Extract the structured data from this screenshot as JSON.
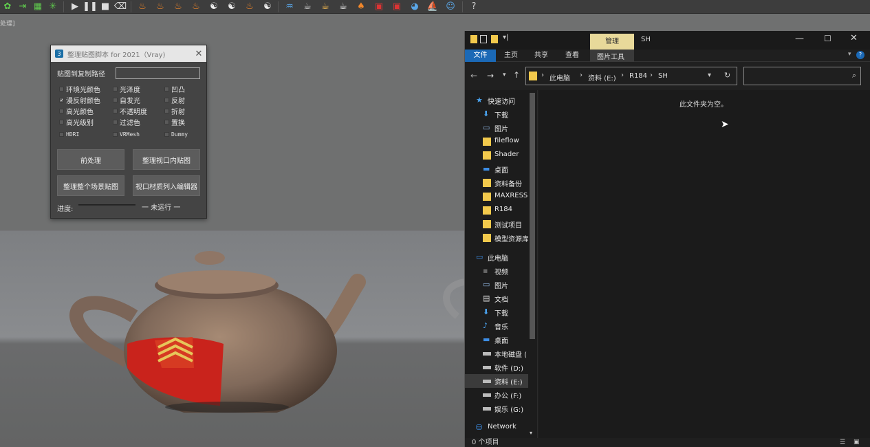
{
  "viewport_label": "处理]",
  "plugin_dialog": {
    "title": "整理贴图脚本 for 2021（Vray)",
    "logo_text": "3",
    "path_label": "贴图到复制路径",
    "path_value": "",
    "checkboxes": [
      {
        "label": "环境光颜色",
        "checked": false
      },
      {
        "label": "光泽度",
        "checked": false
      },
      {
        "label": "凹凸",
        "checked": false
      },
      {
        "label": "漫反射颜色",
        "checked": true
      },
      {
        "label": "自发光",
        "checked": false
      },
      {
        "label": "反射",
        "checked": false
      },
      {
        "label": "高光颜色",
        "checked": false
      },
      {
        "label": "不透明度",
        "checked": false
      },
      {
        "label": "折射",
        "checked": false
      },
      {
        "label": "高光级别",
        "checked": false
      },
      {
        "label": "过滤色",
        "checked": false
      },
      {
        "label": "置换",
        "checked": false
      },
      {
        "label": "HDRI",
        "checked": false
      },
      {
        "label": "VRMesh",
        "checked": false
      },
      {
        "label": "Dummy",
        "checked": false
      }
    ],
    "buttons": [
      "前处理",
      "整理视口内贴图",
      "整理整个场景贴图",
      "视口材质列入编辑器"
    ],
    "progress_label": "进度:",
    "progress_value": 0,
    "progress_status": "一 未运行 一"
  },
  "explorer": {
    "manage_tab": "管理",
    "window_title": "SH",
    "ribbon_tabs": [
      "文件",
      "主页",
      "共享",
      "查看"
    ],
    "tools_tab": "图片工具",
    "address": [
      "此电脑",
      "资料 (E:)",
      "R184",
      "SH"
    ],
    "search_placeholder": "",
    "empty_message": "此文件夹为空。",
    "status": "0 个项目",
    "nav_items": [
      {
        "label": "快速访问",
        "icon": "star-icon"
      },
      {
        "label": "下载",
        "icon": "download-icon"
      },
      {
        "label": "图片",
        "icon": "picture-icon"
      },
      {
        "label": "fileflow",
        "icon": "folder-icon"
      },
      {
        "label": "Shader",
        "icon": "folder-icon"
      },
      {
        "label": "桌面",
        "icon": "desktop-icon"
      },
      {
        "label": "资料备份",
        "icon": "folder-icon"
      },
      {
        "label": "MAXRESS",
        "icon": "folder-icon"
      },
      {
        "label": "R184",
        "icon": "folder-icon"
      },
      {
        "label": "测试项目",
        "icon": "folder-icon"
      },
      {
        "label": "模型资源库",
        "icon": "folder-icon"
      },
      {
        "label": "此电脑",
        "icon": "computer-icon"
      },
      {
        "label": "视频",
        "icon": "video-icon"
      },
      {
        "label": "图片",
        "icon": "picture-icon"
      },
      {
        "label": "文档",
        "icon": "document-icon"
      },
      {
        "label": "下载",
        "icon": "download-icon"
      },
      {
        "label": "音乐",
        "icon": "music-icon"
      },
      {
        "label": "桌面",
        "icon": "desktop-icon"
      },
      {
        "label": "本地磁盘 (",
        "icon": "drive-icon"
      },
      {
        "label": "软件 (D:)",
        "icon": "drive-icon"
      },
      {
        "label": "资料 (E:)",
        "icon": "drive-icon",
        "selected": true
      },
      {
        "label": "办公 (F:)",
        "icon": "drive-icon"
      },
      {
        "label": "娱乐 (G:)",
        "icon": "drive-icon"
      },
      {
        "label": "Network",
        "icon": "network-icon"
      }
    ]
  },
  "toolbar_icons": [
    "teapot-icon",
    "move-icon",
    "grid-icon",
    "burst-icon",
    "play-icon",
    "pause-icon",
    "stop-icon",
    "trash-icon",
    "flame-icon",
    "flame-icon",
    "flame-icon",
    "flame-icon",
    "swirl-icon",
    "swirl-icon",
    "flame-icon",
    "swirl-icon",
    "water-icon",
    "teapot-icon",
    "cup-icon",
    "cup-icon",
    "bucket-icon",
    "cube-icon",
    "cube-icon",
    "sphere-icon",
    "sail-icon",
    "face-icon",
    "help-icon"
  ],
  "colors": {
    "explorer_accent": "#1b69b6",
    "manage_tab": "#e8d99a",
    "teapot_red": "#c9231c"
  }
}
